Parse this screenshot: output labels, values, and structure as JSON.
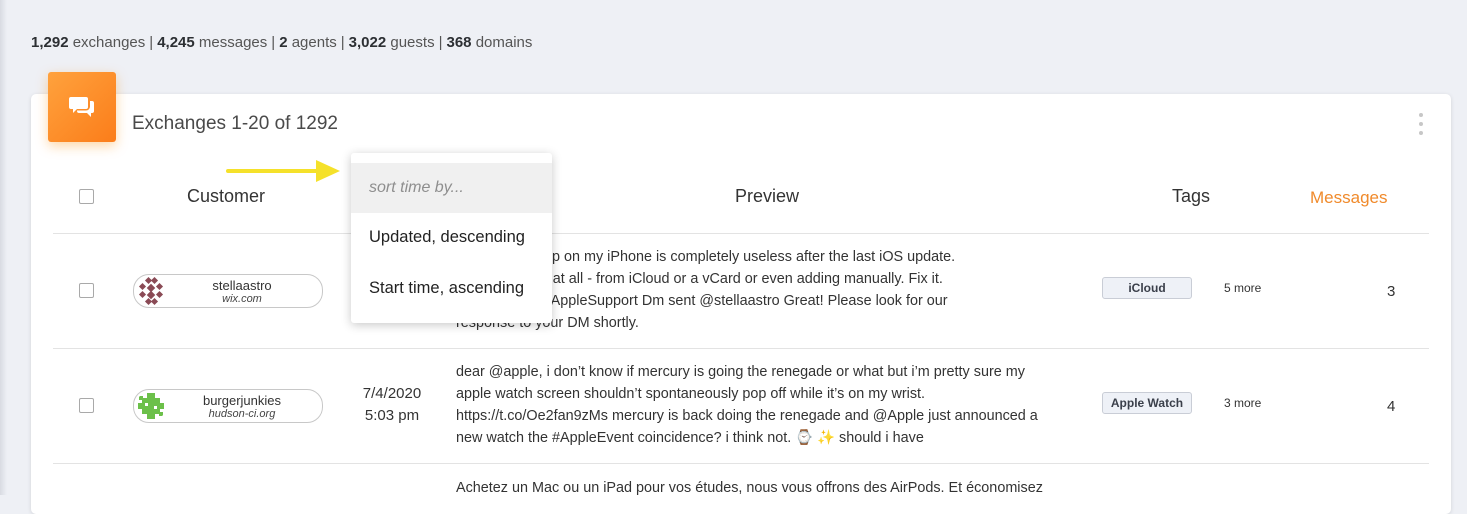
{
  "stats": {
    "exchanges_count": "1,292",
    "exchanges_label": "exchanges",
    "messages_count": "4,245",
    "messages_label": "messages",
    "agents_count": "2",
    "agents_label": "agents",
    "guests_count": "3,022",
    "guests_label": "guests",
    "domains_count": "368",
    "domains_label": "domains",
    "separator": "|"
  },
  "card": {
    "title": "Exchanges 1-20 of 1292"
  },
  "columns": {
    "customer": "Customer",
    "preview": "Preview",
    "tags": "Tags",
    "messages": "Messages"
  },
  "sort_menu": {
    "placeholder": "sort time by...",
    "options": [
      "Updated, descending",
      "Start time, ascending"
    ]
  },
  "rows": [
    {
      "customer_name": "stellaastro",
      "customer_domain": "wix.com",
      "preview_lines": [
        "ny Contacts app on my iPhone is completely useless after the last iOS update.",
        "d any contacts at all - from iCloud or a vCard or even adding manually. Fix it.",
        "honeupdate @AppleSupport Dm sent @stellaastro Great! Please look for our",
        "response to your DM shortly."
      ],
      "tag": "iCloud",
      "more_tags": "5 more",
      "messages": "3"
    },
    {
      "customer_name": "burgerjunkies",
      "customer_domain": "hudson-ci.org",
      "date": "7/4/2020",
      "time": "5:03 pm",
      "preview_lines": [
        "dear @apple, i don’t know if mercury is going the renegade or what but i’m pretty sure my",
        "apple watch screen shouldn’t spontaneously pop off while it’s on my wrist.",
        "https://t.co/Oe2fan9zMs mercury is back doing the renegade and @Apple just announced a",
        "new watch the #AppleEvent  coincidence? i think not. ⌚ ✨  should i have"
      ],
      "tag": "Apple Watch",
      "more_tags": "3 more",
      "messages": "4"
    },
    {
      "preview_lines": [
        "Achetez un Mac ou un iPad pour vos études, nous vous offrons des AirPods. Et économisez"
      ]
    }
  ],
  "colors": {
    "accent_orange": "#f08a2b",
    "icon_gradient_start": "#ffa23d",
    "icon_gradient_end": "#fb7d1a",
    "annotation_arrow": "#f5e12a"
  },
  "icons": {
    "card_icon": "chat-bubbles-icon",
    "menu_icon": "kebab-menu-icon"
  }
}
